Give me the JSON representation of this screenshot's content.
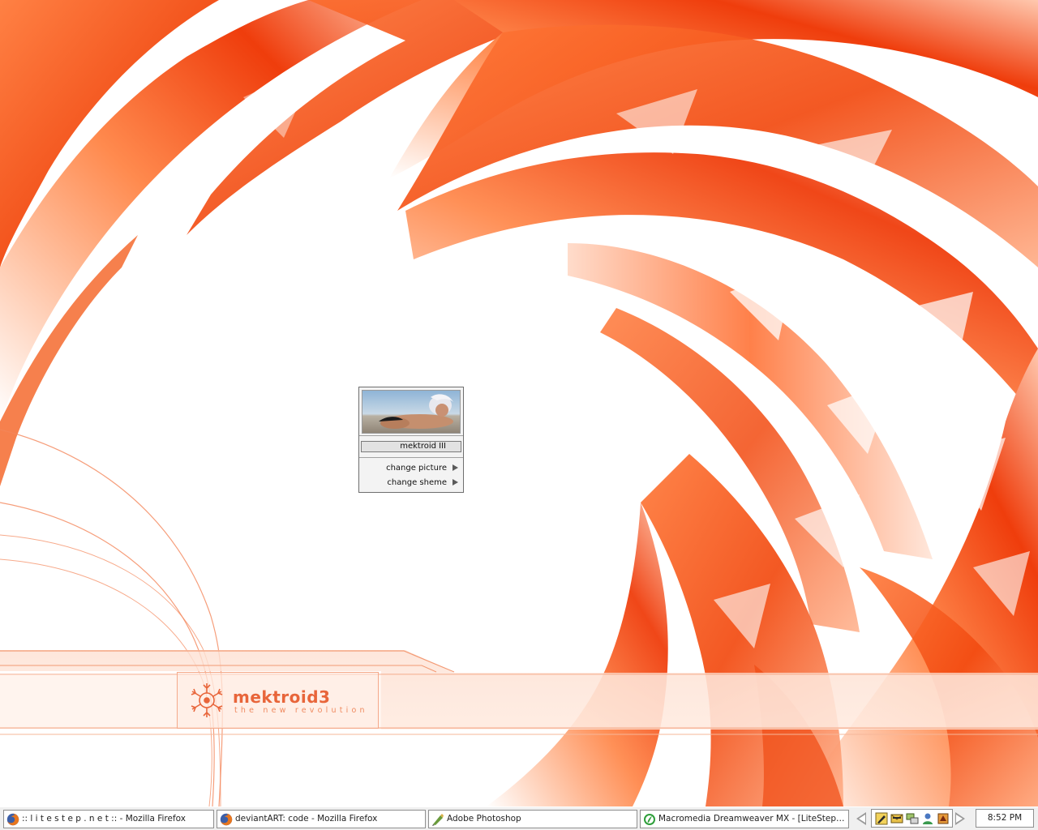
{
  "desktop": {
    "wallpaper": "orange-swirl-abstract",
    "accent_color": "#f25a1c",
    "logo": {
      "title": "mektroid3",
      "tagline": "the new revolution",
      "emblem_icon": "snowflake-emblem-icon"
    }
  },
  "popup": {
    "profile_name": "mektroid III",
    "items": [
      {
        "label": "change picture",
        "icon": "submenu-arrow-icon"
      },
      {
        "label": "change sheme",
        "icon": "submenu-arrow-icon"
      }
    ]
  },
  "taskbar": {
    "tasks": [
      {
        "label": ":: l i t e s t e p . n e t :: - Mozilla Firefox",
        "icon": "firefox-icon"
      },
      {
        "label": "deviantART: code - Mozilla Firefox",
        "icon": "firefox-icon"
      },
      {
        "label": "Adobe Photoshop",
        "icon": "photoshop-icon"
      },
      {
        "label": "Macromedia Dreamweaver MX - [LiteStep Th...",
        "icon": "dreamweaver-icon"
      }
    ],
    "tray_icons": [
      "pencil-tool-icon",
      "mail-icon",
      "network-icon",
      "user-icon",
      "application-icon"
    ],
    "clock": "8:52 PM"
  }
}
